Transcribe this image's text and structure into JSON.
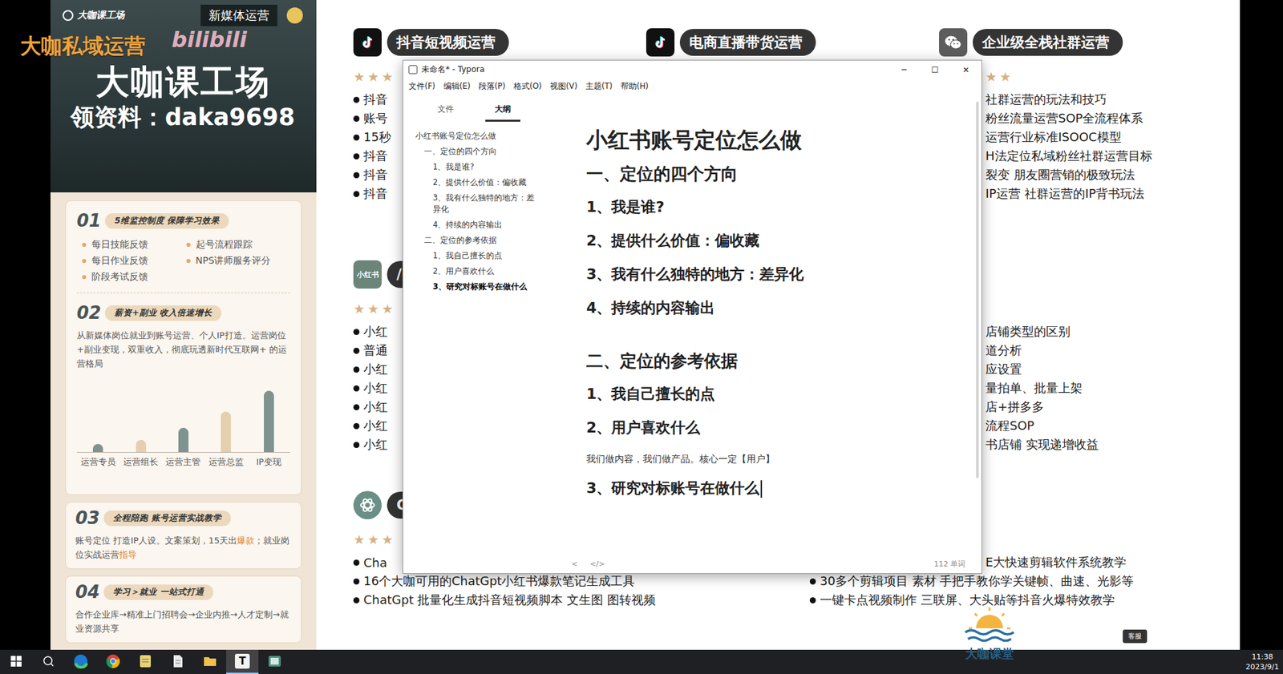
{
  "overlays": {
    "watermark": "大咖私域运营",
    "bilibili": "bilibili",
    "brand": "大咖课堂",
    "service": "客服"
  },
  "poster": {
    "logo": "大咖课工场",
    "tag": "新媒体运营",
    "title": "大咖课工场",
    "contact": "领资料：daka9698",
    "main_sections": [
      {
        "number": "01",
        "title": "5维监控制度 保障学习效果",
        "kind": "list",
        "items": [
          "每日技能反馈",
          "起号流程跟踪",
          "每日作业反馈",
          "NPS讲师服务评分",
          "阶段考试反馈"
        ]
      },
      {
        "number": "02",
        "title": "薪资+副业 收入倍速增长",
        "kind": "chart",
        "text": "从新媒体岗位就业到账号运营、个人IP打造。运营岗位+副业变现，双重收入，彻底玩透新时代互联网+ 的运营格局",
        "chart": {
          "labels": [
            "运营专员",
            "运营组长",
            "运营主管",
            "运营总监",
            "IP变现"
          ],
          "values": [
            12,
            18,
            36,
            60,
            91
          ]
        }
      }
    ],
    "cards": [
      {
        "number": "03",
        "title": "全程陪跑 账号运营实战教学",
        "segments": [
          {
            "text": "账号定位 打造IP人设。文案策划，15天出",
            "highlight": false
          },
          {
            "text": "爆款",
            "highlight": true
          },
          {
            "text": "；就业岗位实战运营",
            "highlight": false
          },
          {
            "text": "指导",
            "highlight": true
          }
        ]
      },
      {
        "number": "04",
        "title": "学习＞就业 一站式打通",
        "segments": [
          {
            "text": "合作企业库→精准上门招聘会→企业内推→人才定制→就业资源共享",
            "highlight": false
          }
        ]
      }
    ]
  },
  "page": {
    "rows": [
      {
        "columns": [
          {
            "header": {
              "kind": "douyin",
              "label": "抖音短视频运营"
            },
            "stars": "★★★",
            "items": [
              {
                "text": "抖音",
                "kind": "bullet"
              },
              {
                "text": "账号",
                "kind": "bullet"
              },
              {
                "text": "15秒",
                "kind": "bullet"
              },
              {
                "text": "抖音",
                "kind": "bullet"
              },
              {
                "text": "抖音",
                "kind": "bullet"
              },
              {
                "text": "抖音",
                "kind": "bullet"
              }
            ]
          },
          {
            "header": {
              "kind": "douyin",
              "label": "电商直播带货运营"
            },
            "stars": "",
            "items": []
          },
          {
            "header": {
              "kind": "wechat",
              "label": "企业级全栈社群运营"
            },
            "stars": "★★",
            "items": [
              {
                "text": "社群运营的玩法和技巧",
                "kind": "clipped"
              },
              {
                "text": "粉丝流量运营SOP全流程体系",
                "kind": "clipped"
              },
              {
                "text": "运营行业标准ISOOC模型",
                "kind": "clipped"
              },
              {
                "text": "H法定位私域粉丝社群运营目标",
                "kind": "clipped"
              },
              {
                "text": "裂变 朋友圈营销的极致玩法",
                "kind": "clipped"
              },
              {
                "text": "IP运营 社群运营的IP背书玩法",
                "kind": "clipped"
              }
            ]
          }
        ]
      },
      {
        "columns": [
          {
            "header": {
              "kind": "xiaohongshu",
              "badge": "小红书",
              "label": "/"
            },
            "stars": "★★★",
            "items": [
              {
                "text": "小红",
                "kind": "bullet"
              },
              {
                "text": "普通",
                "kind": "bullet"
              },
              {
                "text": "小红",
                "kind": "bullet"
              },
              {
                "text": "小红",
                "kind": "bullet"
              },
              {
                "text": "小红",
                "kind": "bullet"
              },
              {
                "text": "小红",
                "kind": "bullet"
              },
              {
                "text": "小红",
                "kind": "bullet"
              }
            ]
          },
          null,
          {
            "header": null,
            "stars": "",
            "items": [
              {
                "text": "店铺类型的区别",
                "kind": "clipped"
              },
              {
                "text": "道分析",
                "kind": "clipped"
              },
              {
                "text": "应设置",
                "kind": "clipped"
              },
              {
                "text": "量拍单、批量上架",
                "kind": "clipped"
              },
              {
                "text": "店+拼多多",
                "kind": "clipped"
              },
              {
                "text": "流程SOP",
                "kind": "clipped"
              },
              {
                "text": "书店铺 实现递增收益",
                "kind": "clipped"
              }
            ]
          }
        ]
      },
      {
        "columns": [
          {
            "header": {
              "kind": "chatgpt",
              "label": "C"
            },
            "stars": "★★★",
            "items": [
              {
                "text": "Cha",
                "kind": "bullet"
              },
              {
                "text": "16个大咖可用的ChatGpt小红书爆款笔记生成工具",
                "kind": "bullet"
              },
              {
                "text": "ChatGpt 批量化生成抖音短视频脚本 文生图 图转视频",
                "kind": "bullet"
              }
            ]
          },
          {
            "header": null,
            "stars": "",
            "items": [
              {
                "text": "E大快速剪辑软件系统教学",
                "kind": "clipped"
              },
              {
                "text": "30多个剪辑项目 素材 手把手教你学关键帧、曲速、光影等",
                "kind": "bullet"
              },
              {
                "text": "一键卡点视频制作 三联屏、大头贴等抖音火爆特效教学",
                "kind": "bullet"
              }
            ]
          }
        ]
      }
    ]
  },
  "typora": {
    "title": "未命名* - Typora",
    "controls": [
      "─",
      "☐",
      "✕"
    ],
    "menu": [
      "文件(F)",
      "编辑(E)",
      "段落(P)",
      "格式(O)",
      "视图(V)",
      "主题(T)",
      "帮助(H)"
    ],
    "sidebar_tabs": [
      {
        "label": "文件",
        "selected": false
      },
      {
        "label": "大纲",
        "selected": true
      }
    ],
    "outline": [
      {
        "text": "小红书账号定位怎么做",
        "level": 0,
        "selected": false
      },
      {
        "text": "一、定位的四个方向",
        "level": 1,
        "selected": false
      },
      {
        "text": "1、我是谁?",
        "level": 2,
        "selected": false
      },
      {
        "text": "2、提供什么价值：偏收藏",
        "level": 2,
        "selected": false
      },
      {
        "text": "3、我有什么独特的地方：差异化",
        "level": 2,
        "selected": false
      },
      {
        "text": "4、持续的内容输出",
        "level": 2,
        "selected": false
      },
      {
        "text": "二、定位的参考依据",
        "level": 1,
        "selected": false
      },
      {
        "text": "1、我自己擅长的点",
        "level": 2,
        "selected": false
      },
      {
        "text": "2、用户喜欢什么",
        "level": 2,
        "selected": false
      },
      {
        "text": "3、研究对标账号在做什么",
        "level": 2,
        "selected": true
      }
    ],
    "document": [
      {
        "kind": "h1",
        "text": "小红书账号定位怎么做",
        "cursor": false
      },
      {
        "kind": "h2",
        "text": "一、定位的四个方向",
        "cursor": false
      },
      {
        "kind": "h3",
        "text": "1、我是谁?",
        "cursor": false
      },
      {
        "kind": "h3",
        "text": "2、提供什么价值：偏收藏",
        "cursor": false
      },
      {
        "kind": "h3",
        "text": "3、我有什么独特的地方：差异化",
        "cursor": false
      },
      {
        "kind": "h3",
        "text": "4、持续的内容输出",
        "cursor": false
      },
      {
        "kind": "h2",
        "text": "二、定位的参考依据",
        "cursor": false
      },
      {
        "kind": "h3",
        "text": "1、我自己擅长的点",
        "cursor": false
      },
      {
        "kind": "h3",
        "text": "2、用户喜欢什么",
        "cursor": false
      },
      {
        "kind": "p",
        "text": "我们做内容，我们做产品。核心一定【用户】",
        "cursor": false
      },
      {
        "kind": "h3",
        "text": "3、研究对标账号在做什么",
        "cursor": true
      }
    ],
    "footer": {
      "left": [
        "<",
        "</>"
      ],
      "word_count": "112 单词"
    }
  },
  "taskbar": {
    "apps": [
      {
        "kind": "edge",
        "selected": false
      },
      {
        "kind": "chrome",
        "selected": false
      },
      {
        "kind": "notes",
        "selected": false
      },
      {
        "kind": "doc",
        "selected": false
      },
      {
        "kind": "folder",
        "selected": false
      },
      {
        "kind": "typora",
        "label": "T",
        "selected": true
      },
      {
        "kind": "app",
        "selected": false
      }
    ],
    "time": "11:38",
    "date": "2023/9/1"
  }
}
